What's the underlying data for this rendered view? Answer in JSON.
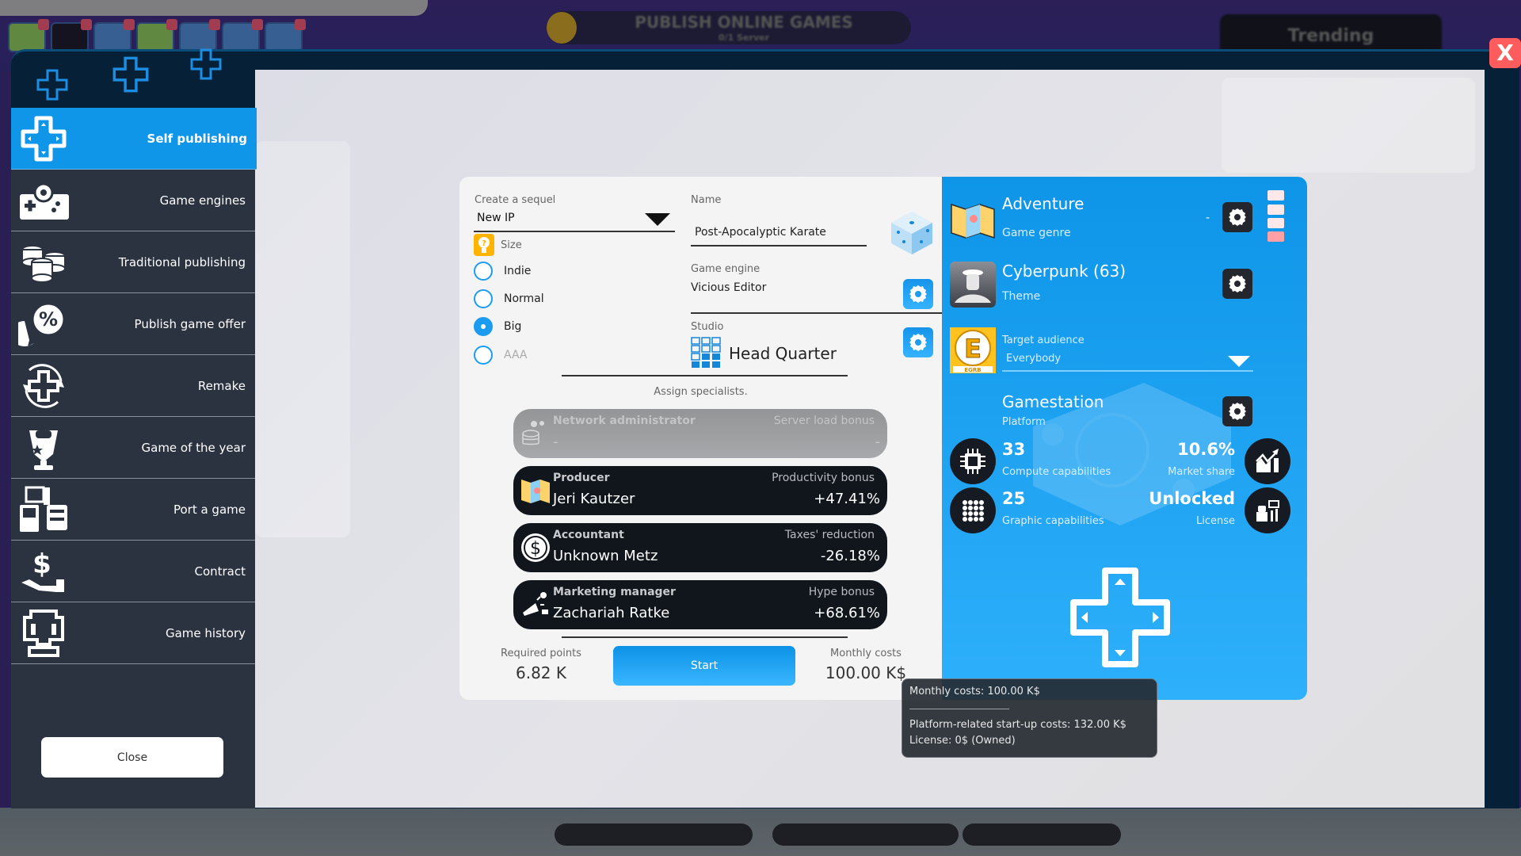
{
  "background": {
    "publish_banner": {
      "title": "PUBLISH ONLINE GAMES",
      "subtitle": "0/1 Server"
    },
    "trending_label": "Trending"
  },
  "window": {
    "close_icon_label": "X"
  },
  "sidebar": {
    "items": [
      {
        "label": "Self publishing",
        "icon": "dpad-icon",
        "active": true
      },
      {
        "label": "Game engines",
        "icon": "gamepad-gear-icon"
      },
      {
        "label": "Traditional publishing",
        "icon": "coin-stacks-icon"
      },
      {
        "label": "Publish game offer",
        "icon": "percent-bubble-icon"
      },
      {
        "label": "Remake",
        "icon": "dpad-refresh-icon"
      },
      {
        "label": "Game of the year",
        "icon": "trophy-icon"
      },
      {
        "label": "Port a game",
        "icon": "devices-icon"
      },
      {
        "label": "Contract",
        "icon": "hand-dollar-icon"
      },
      {
        "label": "Game history",
        "icon": "arcade-icon"
      }
    ],
    "close_label": "Close"
  },
  "dialog": {
    "sequel": {
      "label": "Create a sequel",
      "value": "New IP"
    },
    "size": {
      "label": "Size",
      "options": [
        {
          "label": "Indie",
          "selected": false,
          "enabled": true
        },
        {
          "label": "Normal",
          "selected": false,
          "enabled": true
        },
        {
          "label": "Big",
          "selected": true,
          "enabled": true
        },
        {
          "label": "AAA",
          "selected": false,
          "enabled": false
        }
      ]
    },
    "name": {
      "label": "Name",
      "value": "Post-Apocalyptic Karate"
    },
    "engine": {
      "label": "Game engine",
      "value": "Vicious Editor"
    },
    "studio": {
      "label": "Studio",
      "value": "Head Quarter"
    },
    "specialists_heading": "Assign specialists.",
    "specialists": [
      {
        "role": "Network administrator",
        "bonus_label": "Server load bonus",
        "person": "-",
        "bonus": "-",
        "enabled": false
      },
      {
        "role": "Producer",
        "bonus_label": "Productivity bonus",
        "person": "Jeri Kautzer",
        "bonus": "+47.41%",
        "enabled": true
      },
      {
        "role": "Accountant",
        "bonus_label": "Taxes' reduction",
        "person": "Unknown Metz",
        "bonus": "-26.18%",
        "enabled": true
      },
      {
        "role": "Marketing manager",
        "bonus_label": "Hype bonus",
        "person": "Zachariah Ratke",
        "bonus": "+68.61%",
        "enabled": true
      }
    ],
    "required_points": {
      "label": "Required points",
      "value": "6.82 K"
    },
    "start_label": "Start",
    "monthly_costs": {
      "label": "Monthly costs",
      "value": "100.00 K$"
    },
    "genre": {
      "value": "Adventure",
      "label": "Game genre",
      "indicator": "-"
    },
    "theme": {
      "value": "Cyberpunk (63)",
      "label": "Theme"
    },
    "audience": {
      "label": "Target audience",
      "value": "Everybody",
      "rating_badge": "EGRB"
    },
    "platform": {
      "name": "Gamestation",
      "label": "Platform",
      "compute": {
        "value": "33",
        "label": "Compute capabilities"
      },
      "market_share": {
        "value": "10.6%",
        "label": "Market share"
      },
      "graphic": {
        "value": "25",
        "label": "Graphic capabilities"
      },
      "license": {
        "value": "Unlocked",
        "label": "License"
      }
    }
  },
  "tooltip": {
    "line1": "Monthly costs: 100.00 K$",
    "line2": "Platform-related start-up costs: 132.00 K$",
    "line3": "License: 0$ (Owned)"
  },
  "colors": {
    "accent_blue": "#0f96e8",
    "sidebar_bg": "#2b3240",
    "close_red": "#ff5d5d",
    "specialist_bg": "#11151c"
  }
}
